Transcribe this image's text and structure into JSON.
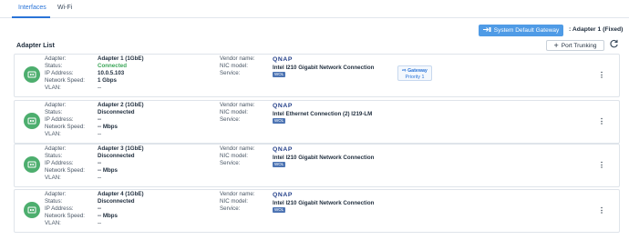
{
  "tabs": [
    {
      "label": "Interfaces",
      "active": true
    },
    {
      "label": "Wi-Fi",
      "active": false
    }
  ],
  "gateway": {
    "button_label": "System Default Gateway",
    "button_icon": "gateway-icon",
    "current": ": Adapter 1 (Fixed)"
  },
  "adapter_list": {
    "title": "Adapter List",
    "port_trunking_label": "Port Trunking",
    "labels": {
      "adapter": "Adapter:",
      "status": "Status:",
      "ip": "IP Address:",
      "speed": "Network Speed:",
      "vlan": "VLAN:",
      "vendor": "Vendor name:",
      "nic_model": "NIC model:",
      "service": "Service:"
    },
    "adapters": [
      {
        "name": "Adapter 1 (1GbE)",
        "status": "Connected",
        "ip": "10.0.5.103",
        "speed": "1 Gbps",
        "vlan": "--",
        "vendor_logo": "QNAP",
        "nic_model": "Intel I210 Gigabit Network Connection",
        "wol": "WOL",
        "gateway_tag": "Gateway",
        "priority": "Priority 1"
      },
      {
        "name": "Adapter 2 (1GbE)",
        "status": "Disconnected",
        "ip": "--",
        "speed": "-- Mbps",
        "vlan": "--",
        "vendor_logo": "QNAP",
        "nic_model": "Intel Ethernet Connection (2) I219-LM",
        "wol": "WOL"
      },
      {
        "name": "Adapter 3 (1GbE)",
        "status": "Disconnected",
        "ip": "--",
        "speed": "-- Mbps",
        "vlan": "--",
        "vendor_logo": "QNAP",
        "nic_model": "Intel I210 Gigabit Network Connection",
        "wol": "WOL"
      },
      {
        "name": "Adapter 4 (1GbE)",
        "status": "Disconnected",
        "ip": "--",
        "speed": "-- Mbps",
        "vlan": "--",
        "vendor_logo": "QNAP",
        "nic_model": "Intel I210 Gigabit Network Connection",
        "wol": "WOL"
      }
    ]
  },
  "colors": {
    "accent": "#2a74d8",
    "connected": "#3aa658",
    "adapter_icon": "#4dae6e",
    "gateway_button": "#4f9be6"
  }
}
